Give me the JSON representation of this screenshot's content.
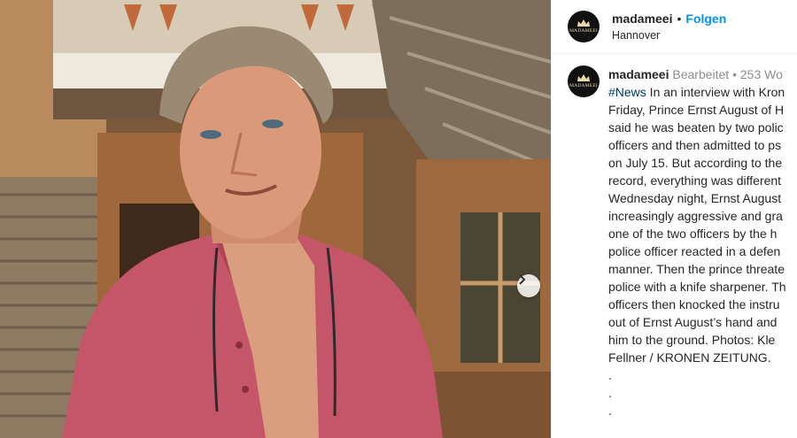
{
  "post": {
    "username": "madameei",
    "follow_label": "Folgen",
    "location": "Hannover",
    "avatar_text": "MADAMEEI"
  },
  "caption": {
    "username": "madameei",
    "edited": "Bearbeitet",
    "separator": "•",
    "age": "253 Wo",
    "hashtag": "#News",
    "line1": " In an interview with Kron",
    "lines": [
      "Friday, Prince Ernst August of H",
      "said he was beaten by two polic",
      "officers and then admitted to ps",
      "on July 15. But according to the",
      "record, everything was different",
      "Wednesday night, Ernst August",
      "increasingly aggressive and gra",
      "one of the two officers by the h",
      "police officer reacted in a defen",
      "manner. Then the prince threate",
      "police with a knife sharpener. Th",
      "officers then knocked the instru",
      "out of Ernst August’s hand and",
      "him to the ground. Photos: Kle",
      "Fellner / KRONEN ZEITUNG."
    ],
    "trailing": [
      ".",
      ".",
      "."
    ]
  },
  "icons": {
    "next": "chevron-right-icon",
    "avatar": "crown-logo"
  }
}
